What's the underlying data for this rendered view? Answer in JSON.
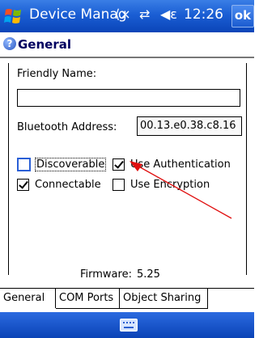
{
  "titlebar": {
    "title": "Device Manag",
    "clock": "12:26",
    "ok_label": "ok"
  },
  "header": {
    "title": "General"
  },
  "form": {
    "friendly_name_label": "Friendly Name:",
    "friendly_name_value": "",
    "bt_address_label": "Bluetooth Address:",
    "bt_address_value": "00.13.e0.38.c8.16",
    "discoverable_label": "Discoverable",
    "discoverable_checked": false,
    "use_auth_label": "Use Authentication",
    "use_auth_checked": true,
    "connectable_label": "Connectable",
    "connectable_checked": true,
    "use_enc_label": "Use Encryption",
    "use_enc_checked": false,
    "firmware_label": "Firmware:",
    "firmware_value": "5.25"
  },
  "tabs": [
    "General",
    "COM Ports",
    "Object Sharing"
  ],
  "colors": {
    "titlebar": "#1a5ed4",
    "annotation_arrow": "#e01010"
  },
  "icons": {
    "start": "windows-flag-icon",
    "connectivity": "connectivity-icon",
    "signal": "signal-icon",
    "volume": "volume-icon",
    "help": "help-icon",
    "keyboard": "keyboard-icon"
  }
}
